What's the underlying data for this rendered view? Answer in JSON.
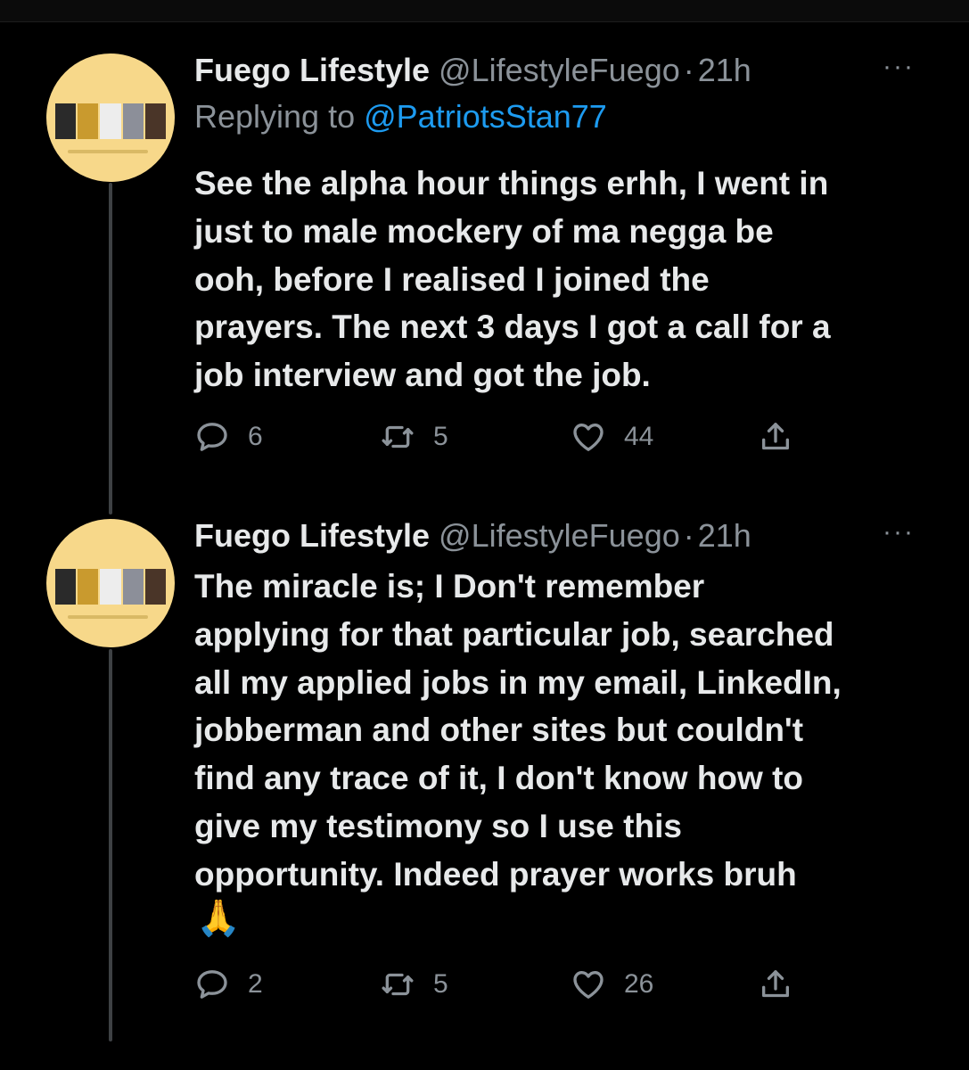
{
  "tweets": [
    {
      "author_name": "Fuego Lifestyle",
      "handle": "@LifestyleFuego",
      "separator": "·",
      "time": "21h",
      "more": "···",
      "replying_label": "Replying to",
      "replying_to": "@PatriotsStan77",
      "text_lines": [
        "See the alpha hour things erhh, I went in",
        "just to male mockery  of ma negga be",
        "ooh, before I realised I joined the",
        "prayers. The next 3 days I got a call for a",
        "job interview and got the job."
      ],
      "replies": "6",
      "retweets": "5",
      "likes": "44"
    },
    {
      "author_name": "Fuego Lifestyle",
      "handle": "@LifestyleFuego",
      "separator": "·",
      "time": "21h",
      "more": "···",
      "text_lines": [
        "The miracle is; I Don't remember",
        "applying for that particular job, searched",
        "all my applied jobs in my email, LinkedIn,",
        "jobberman and other sites but couldn't",
        "find any trace of it, I don't know how to",
        "give my testimony so I use this",
        "opportunity. Indeed prayer works bruh"
      ],
      "emoji": "🙏",
      "replies": "2",
      "retweets": "5",
      "likes": "26"
    }
  ],
  "icons": {
    "reply": "speech-bubble-icon",
    "retweet": "retweet-icon",
    "like": "heart-icon",
    "share": "share-icon"
  },
  "colors": {
    "background": "#000000",
    "text": "#e7e9ea",
    "muted": "#8b9299",
    "mention": "#1d9bf0",
    "thread_line": "#3e4144"
  }
}
